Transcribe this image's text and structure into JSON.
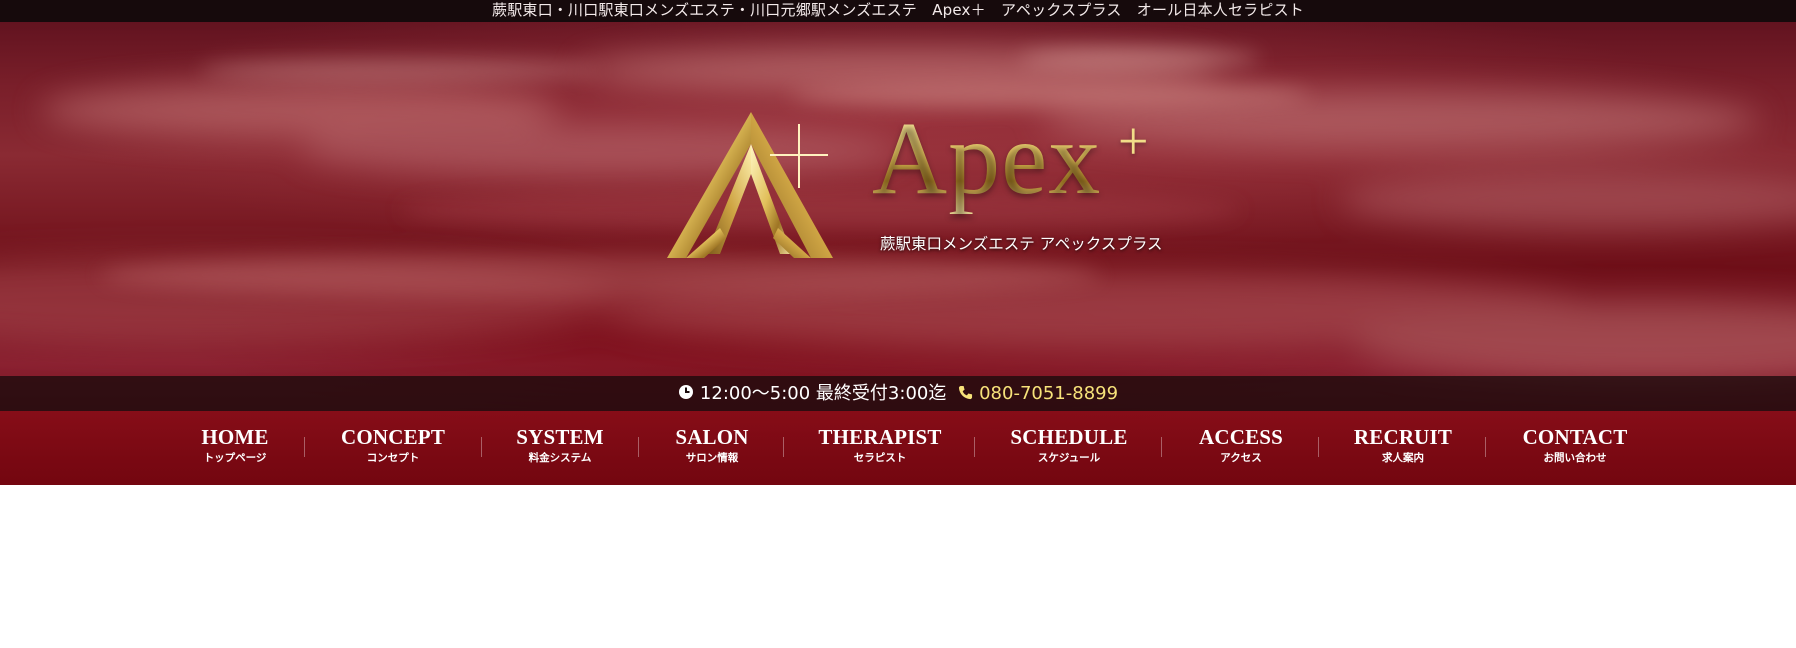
{
  "top_bar": {
    "text": "蕨駅東口・川口駅東口メンズエステ・川口元郷駅メンズエステ　Apex＋　アペックスプラス　オール日本人セラピスト"
  },
  "logo": {
    "brand": "Apex",
    "plus": "+",
    "tagline": "蕨駅東口メンズエステ アペックスプラス"
  },
  "hours_bar": {
    "clock_icon": "clock-icon",
    "hours_text": "12:00〜5:00 最終受付3:00迄",
    "phone_icon": "phone-icon",
    "phone": "080-7051-8899",
    "phone_color": "#f7e27a"
  },
  "nav": {
    "items": [
      {
        "en": "HOME",
        "jp": "トップページ"
      },
      {
        "en": "CONCEPT",
        "jp": "コンセプト"
      },
      {
        "en": "SYSTEM",
        "jp": "料金システム"
      },
      {
        "en": "SALON",
        "jp": "サロン情報"
      },
      {
        "en": "THERAPIST",
        "jp": "セラピスト"
      },
      {
        "en": "SCHEDULE",
        "jp": "スケジュール"
      },
      {
        "en": "ACCESS",
        "jp": "アクセス"
      },
      {
        "en": "RECRUIT",
        "jp": "求人案内"
      },
      {
        "en": "CONTACT",
        "jp": "お問い合わせ"
      }
    ]
  },
  "colors": {
    "accent_gold": "#e9d37c",
    "topbar_bg": "#160a0c",
    "hero_red": "#7a1f2a"
  }
}
